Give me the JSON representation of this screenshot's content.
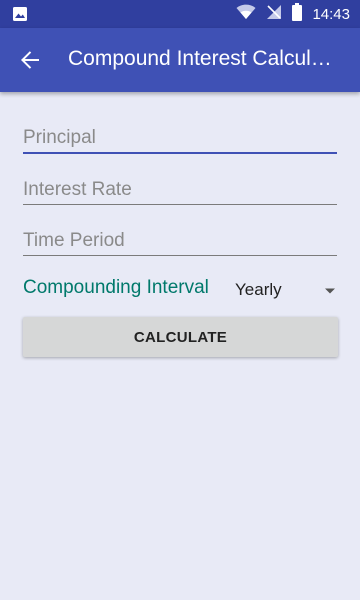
{
  "status_bar": {
    "time": "14:43",
    "icons": [
      "image-icon",
      "wifi-icon",
      "no-signal-icon",
      "battery-icon"
    ]
  },
  "app_bar": {
    "title": "Compound Interest Calculator",
    "back_icon": "arrow-back-icon"
  },
  "form": {
    "principal": {
      "placeholder": "Principal",
      "value": ""
    },
    "rate": {
      "placeholder": "Interest Rate",
      "value": ""
    },
    "time": {
      "placeholder": "Time Period",
      "value": ""
    },
    "interval_label": "Compounding Interval",
    "interval_value": "Yearly",
    "calculate_label": "CALCULATE"
  },
  "colors": {
    "status_bar": "#303f9f",
    "app_bar": "#3f51b5",
    "background": "#e8eaf6",
    "accent_label": "#00796b",
    "button": "#d6d7d7"
  }
}
